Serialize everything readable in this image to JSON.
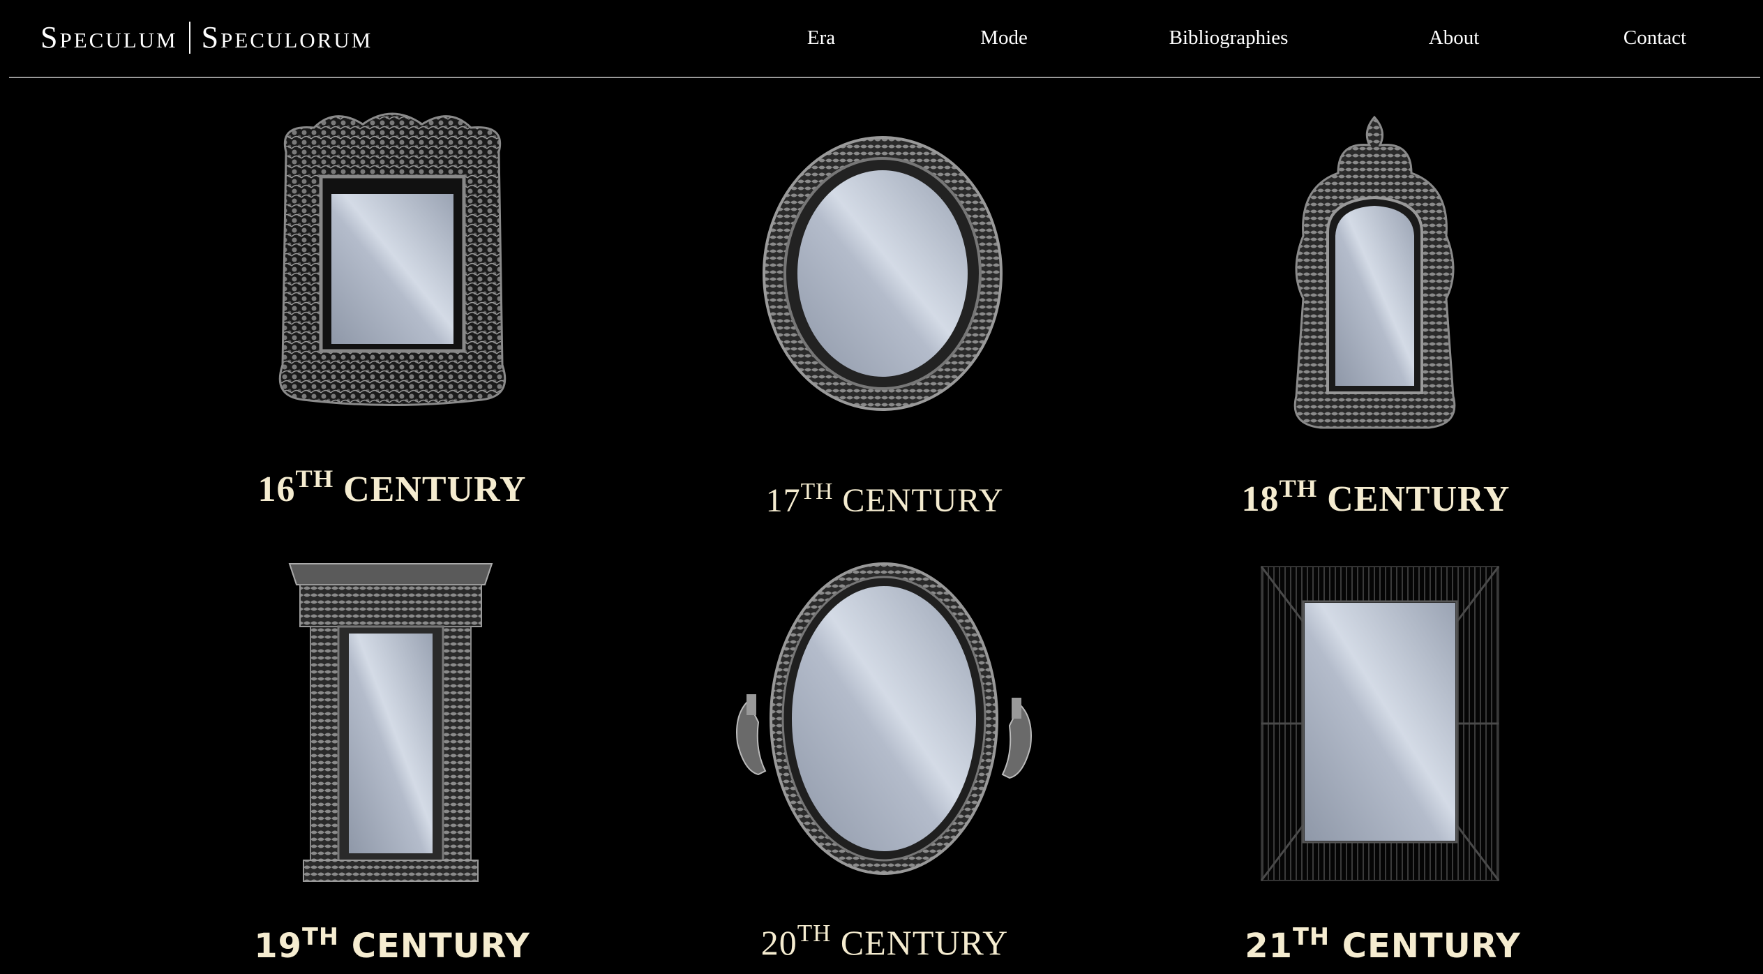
{
  "header": {
    "brand_left": "Speculum",
    "brand_right": "Speculorum",
    "nav": [
      "Era",
      "Mode",
      "Bibliographies",
      "About",
      "Contact"
    ]
  },
  "colors": {
    "background": "#000000",
    "caption": "#f5ecd0",
    "frame": "#6b6b6b",
    "glass_light": "#d4dbe6",
    "glass_dark": "#8f98a8",
    "rule": "#9a9a9a"
  },
  "eras": [
    {
      "number": "16",
      "suffix": "TH",
      "label": "CENTURY",
      "image": "ornate-baroque-rectangular-mirror"
    },
    {
      "number": "17",
      "suffix": "TH",
      "label": "CENTURY",
      "image": "oval-carved-frame-mirror"
    },
    {
      "number": "18",
      "suffix": "TH",
      "label": "CENTURY",
      "image": "rococo-arched-mirror"
    },
    {
      "number": "19",
      "suffix": "TH",
      "label": "CENTURY",
      "image": "pier-column-mirror"
    },
    {
      "number": "20",
      "suffix": "TH",
      "label": "CENTURY",
      "image": "oval-mirror-with-sconces"
    },
    {
      "number": "21",
      "suffix": "TH",
      "label": "CENTURY",
      "image": "sunburst-rectangular-mirror"
    }
  ]
}
